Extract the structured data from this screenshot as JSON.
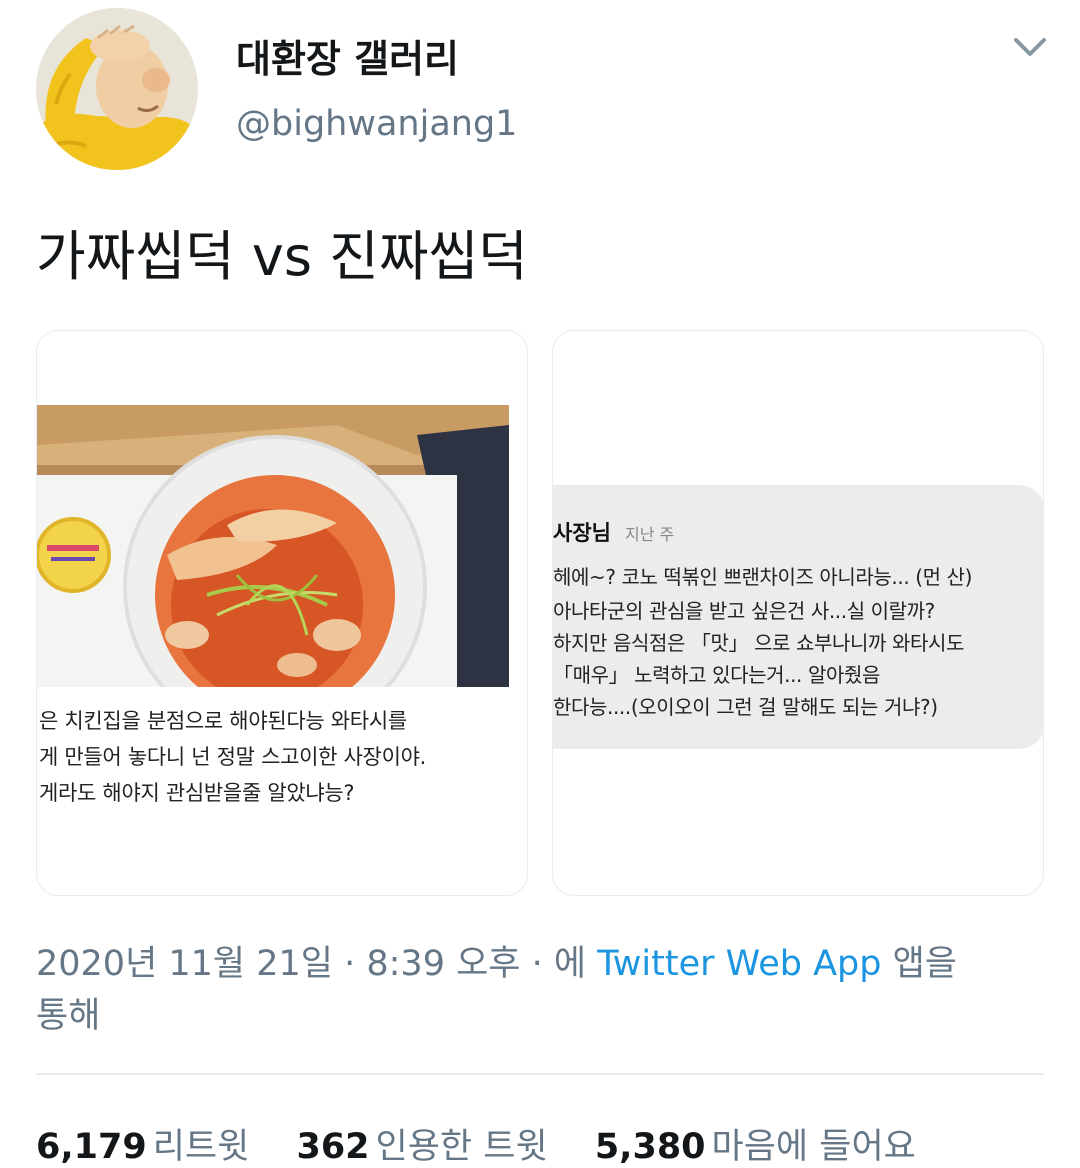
{
  "user": {
    "display_name": "대환장 갤러리",
    "handle": "@bighwanjang1"
  },
  "tweet": {
    "text": "가짜씹덕 vs 진짜씹덕"
  },
  "media": {
    "left": {
      "caption_lines": [
        "은 치킨집을 분점으로 해야된다능 와타시를",
        "게 만들어 놓다니 넌 정말 스고이한 사장이야.",
        "게라도 해야지 관심받을줄 알았냐능?"
      ]
    },
    "right": {
      "author": "사장님",
      "time": "지난 주",
      "lines": [
        "헤에~? 코노 떡볶인 쁘랜차이즈 아니라능... (먼 산)",
        "아나타군의 관심을 받고 싶은건 사...실 이랄까?",
        "하지만 음식점은 「맛」 으로 쇼부나니까 와타시도",
        "「매우」 노력하고 있다는거... 알아줬음",
        "한다능....(오이오이 그런 걸 말해도 되는 거냐?)"
      ]
    }
  },
  "meta": {
    "timestamp": "2020년 11월 21일 · 8:39 오후 · 에",
    "app_name": "Twitter Web App",
    "app_suffix": "앱을",
    "tail": "통해"
  },
  "stats": {
    "retweets": {
      "count": "6,179",
      "label": "리트윗"
    },
    "quotes": {
      "count": "362",
      "label": "인용한 트윗"
    },
    "likes": {
      "count": "5,380",
      "label": "마음에 들어요"
    }
  },
  "colors": {
    "link": "#1b95e0",
    "secondary_text": "#657786",
    "border": "#e6ecf0"
  },
  "icons": {
    "menu": "chevron-down-icon"
  }
}
